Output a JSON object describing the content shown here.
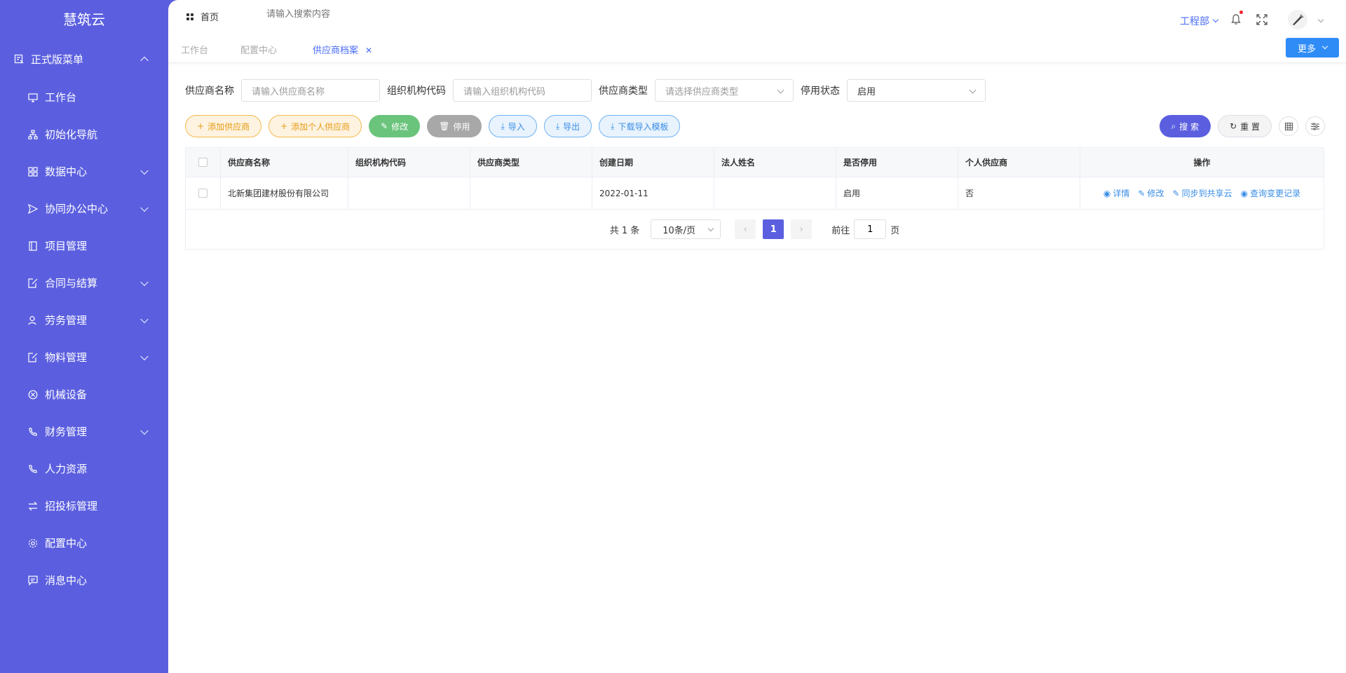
{
  "brand": "慧筑云",
  "sidebar": {
    "items": [
      {
        "label": "正式版菜单",
        "icon": "menu-doc-icon",
        "chevron": "up",
        "top": true
      },
      {
        "label": "工作台",
        "icon": "monitor-icon",
        "chevron": ""
      },
      {
        "label": "初始化导航",
        "icon": "org-chart-icon",
        "chevron": ""
      },
      {
        "label": "数据中心",
        "icon": "grid-icon",
        "chevron": "down"
      },
      {
        "label": "协同办公中心",
        "icon": "send-icon",
        "chevron": "down"
      },
      {
        "label": "项目管理",
        "icon": "book-icon",
        "chevron": ""
      },
      {
        "label": "合同与结算",
        "icon": "edit-doc-icon",
        "chevron": "down"
      },
      {
        "label": "劳务管理",
        "icon": "user-icon",
        "chevron": "down"
      },
      {
        "label": "物料管理",
        "icon": "edit-doc-icon",
        "chevron": "down"
      },
      {
        "label": "机械设备",
        "icon": "circle-x-icon",
        "chevron": ""
      },
      {
        "label": "财务管理",
        "icon": "phone-icon",
        "chevron": "down"
      },
      {
        "label": "人力资源",
        "icon": "phone-icon",
        "chevron": ""
      },
      {
        "label": "招投标管理",
        "icon": "switch-icon",
        "chevron": ""
      },
      {
        "label": "配置中心",
        "icon": "gear-icon",
        "chevron": ""
      },
      {
        "label": "消息中心",
        "icon": "message-icon",
        "chevron": ""
      }
    ]
  },
  "topbar": {
    "home_label": "首页",
    "search_placeholder": "请输入搜索内容",
    "department": "工程部"
  },
  "tabs": [
    {
      "label": "工作台",
      "active": false
    },
    {
      "label": "配置中心",
      "active": false
    },
    {
      "label": "供应商档案",
      "active": true,
      "closable": true
    }
  ],
  "more_button": "更多",
  "filters": [
    {
      "label": "供应商名称",
      "placeholder": "请输入供应商名称",
      "value": "",
      "type": "input"
    },
    {
      "label": "组织机构代码",
      "placeholder": "请输入组织机构代码",
      "value": "",
      "type": "input"
    },
    {
      "label": "供应商类型",
      "placeholder": "请选择供应商类型",
      "value": "",
      "type": "select"
    },
    {
      "label": "停用状态",
      "placeholder": "",
      "value": "启用",
      "type": "select"
    }
  ],
  "actions": {
    "add_supplier": "添加供应商",
    "add_personal_supplier": "添加个人供应商",
    "edit": "修改",
    "disable": "停用",
    "import": "导入",
    "export": "导出",
    "download_template": "下载导入模板",
    "search": "搜 索",
    "reset": "重 置"
  },
  "table": {
    "columns": [
      "供应商名称",
      "组织机构代码",
      "供应商类型",
      "创建日期",
      "法人姓名",
      "是否停用",
      "个人供应商",
      "操作"
    ],
    "rows": [
      {
        "name": "北新集团建材股份有限公司",
        "org_code": "",
        "type": "",
        "created": "2022-01-11",
        "legal_person": "",
        "disabled": "启用",
        "personal": "否",
        "ops": [
          "详情",
          "修改",
          "同步到共享云",
          "查询变更记录"
        ]
      }
    ]
  },
  "pagination": {
    "total": "共 1 条",
    "page_size": "10条/页",
    "current_page": "1",
    "goto_label": "前往",
    "goto_value": "1",
    "page_suffix": "页"
  },
  "colors": {
    "sidebar": "#5b5fdf",
    "link": "#3a8ee6",
    "more_button": "#2f8cf6"
  }
}
